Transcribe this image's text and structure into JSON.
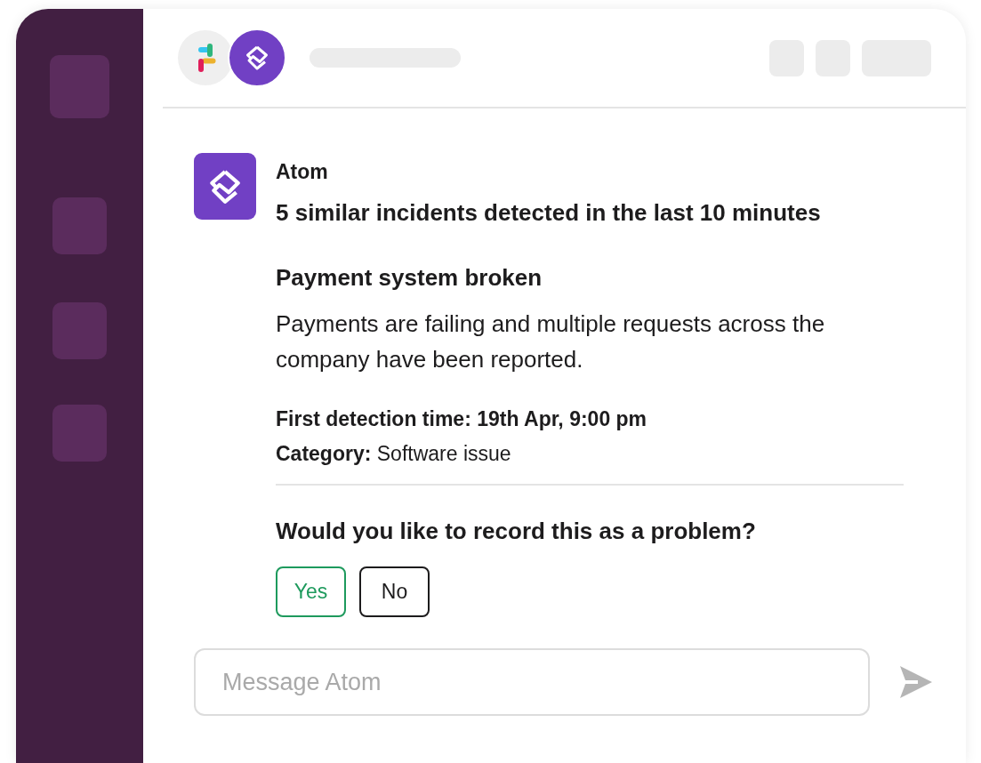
{
  "header": {
    "apps": [
      {
        "kind": "slack"
      },
      {
        "kind": "atom"
      }
    ]
  },
  "message": {
    "sender": "Atom",
    "headline": "5 similar incidents detected in the last 10 minutes",
    "incident": {
      "title": "Payment system broken",
      "description": "Payments are failing and multiple requests across the company have been reported.",
      "details": [
        "**First detection time: 19th Apr, 9:00 pm**",
        "**Category:** Software issue"
      ]
    },
    "question": "Would you like to record this as a problem?",
    "actions": [
      {
        "label": "Yes",
        "kind": "primary"
      },
      {
        "label": "No",
        "kind": "default"
      }
    ]
  },
  "composer": {
    "placeholder": "Message Atom"
  }
}
